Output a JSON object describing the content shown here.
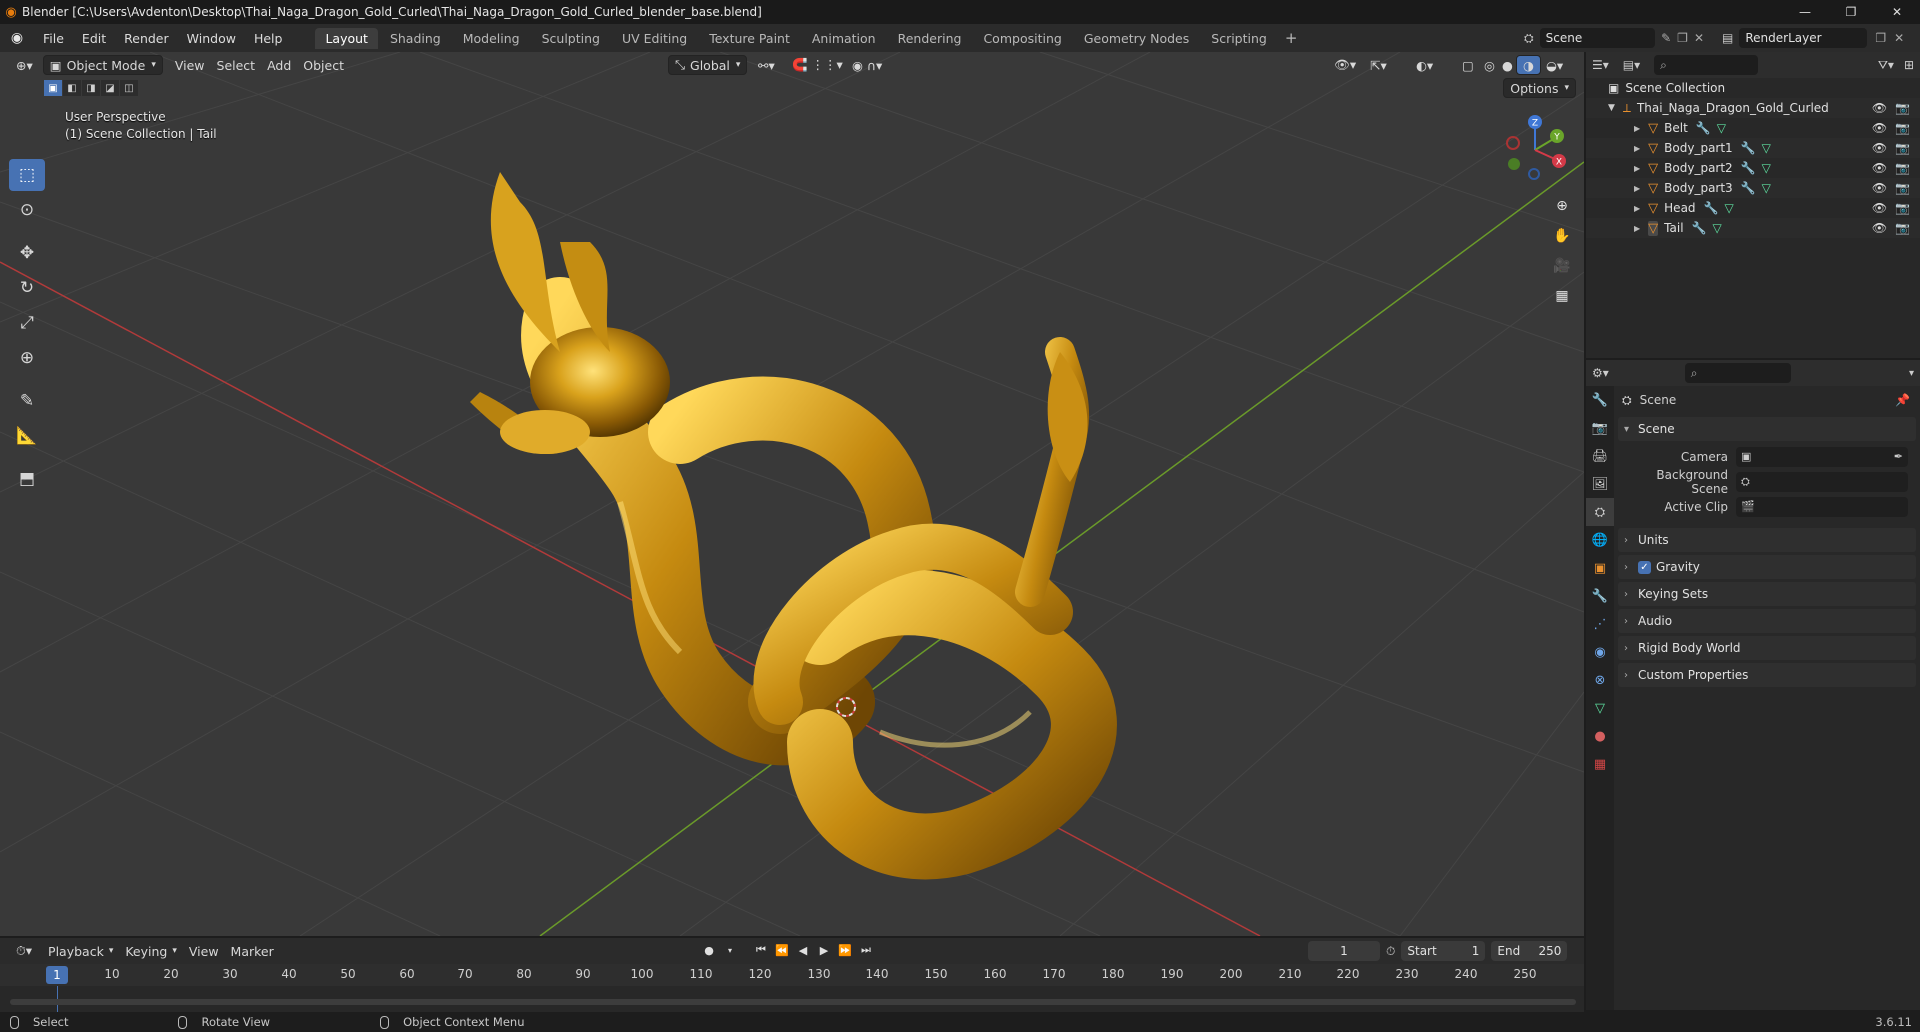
{
  "window": {
    "title": "Blender [C:\\Users\\Avdenton\\Desktop\\Thai_Naga_Dragon_Gold_Curled\\Thai_Naga_Dragon_Gold_Curled_blender_base.blend]",
    "controls": [
      "—",
      "❐",
      "✕"
    ]
  },
  "menu": [
    "File",
    "Edit",
    "Render",
    "Window",
    "Help"
  ],
  "workspaces": [
    "Layout",
    "Shading",
    "Modeling",
    "Sculpting",
    "UV Editing",
    "Texture Paint",
    "Animation",
    "Rendering",
    "Compositing",
    "Geometry Nodes",
    "Scripting"
  ],
  "active_workspace": "Layout",
  "scene_name": "Scene",
  "view_layer": "RenderLayer",
  "viewport": {
    "mode": "Object Mode",
    "menus": [
      "View",
      "Select",
      "Add",
      "Object"
    ],
    "orientation": "Global",
    "options_label": "Options",
    "info_line1": "User Perspective",
    "info_line2": "(1) Scene Collection | Tail",
    "gizmo": {
      "x": "X",
      "y": "Y",
      "z": "Z"
    }
  },
  "outliner": {
    "root": "Scene Collection",
    "collection": "Thai_Naga_Dragon_Gold_Curled",
    "objects": [
      "Belt",
      "Body_part1",
      "Body_part2",
      "Body_part3",
      "Head",
      "Tail"
    ]
  },
  "properties": {
    "context": "Scene",
    "panel_title": "Scene",
    "fields": [
      {
        "label": "Camera",
        "value": ""
      },
      {
        "label": "Background Scene",
        "value": ""
      },
      {
        "label": "Active Clip",
        "value": ""
      }
    ],
    "collapsed_panels": [
      "Units",
      "Gravity",
      "Keying Sets",
      "Audio",
      "Rigid Body World",
      "Custom Properties"
    ],
    "gravity_enabled": true
  },
  "timeline": {
    "menus": [
      "Playback",
      "Keying",
      "View",
      "Marker"
    ],
    "current_frame": "1",
    "start_label": "Start",
    "start": "1",
    "end_label": "End",
    "end": "250",
    "ticks": [
      "1",
      "10",
      "20",
      "30",
      "40",
      "50",
      "60",
      "70",
      "80",
      "90",
      "100",
      "110",
      "120",
      "130",
      "140",
      "150",
      "160",
      "170",
      "180",
      "190",
      "200",
      "210",
      "220",
      "230",
      "240",
      "250"
    ]
  },
  "statusbar": {
    "items": [
      "Select",
      "Rotate View",
      "Object Context Menu"
    ],
    "version": "3.6.11"
  },
  "colors": {
    "accent": "#4772b3",
    "object": "#e9912f",
    "gold": "#d9a21c",
    "x_axis": "#b13a3a",
    "y_axis": "#6a9a2a"
  }
}
